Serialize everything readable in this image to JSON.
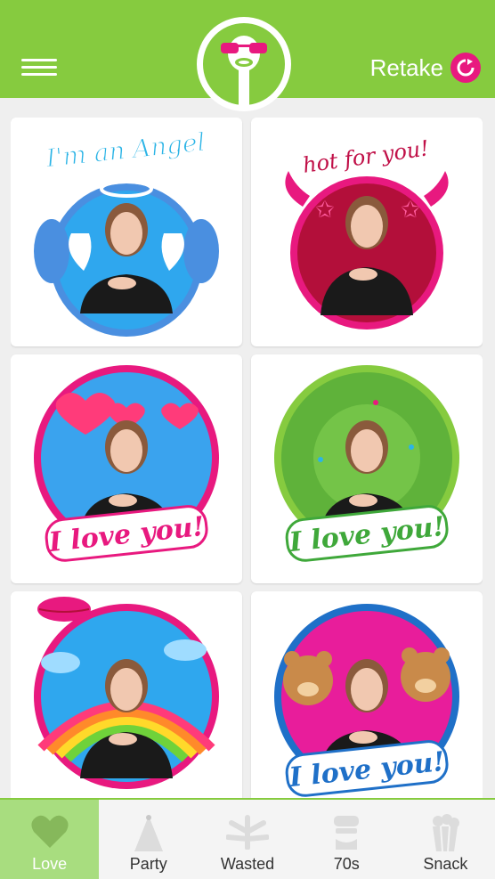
{
  "header": {
    "retake_label": "Retake"
  },
  "stickers": [
    {
      "caption": "I'm an Angel"
    },
    {
      "caption": "hot for you!"
    },
    {
      "caption": "I love you!"
    },
    {
      "caption": "I love you!"
    },
    {
      "caption": ""
    },
    {
      "caption": "I love you!"
    }
  ],
  "tabs": [
    {
      "label": "Love",
      "active": true
    },
    {
      "label": "Party",
      "active": false
    },
    {
      "label": "Wasted",
      "active": false
    },
    {
      "label": "70s",
      "active": false
    },
    {
      "label": "Snack",
      "active": false
    }
  ],
  "colors": {
    "brand_green": "#86cb3f",
    "accent_pink": "#e8197f",
    "active_tab": "#a8dd7f"
  }
}
